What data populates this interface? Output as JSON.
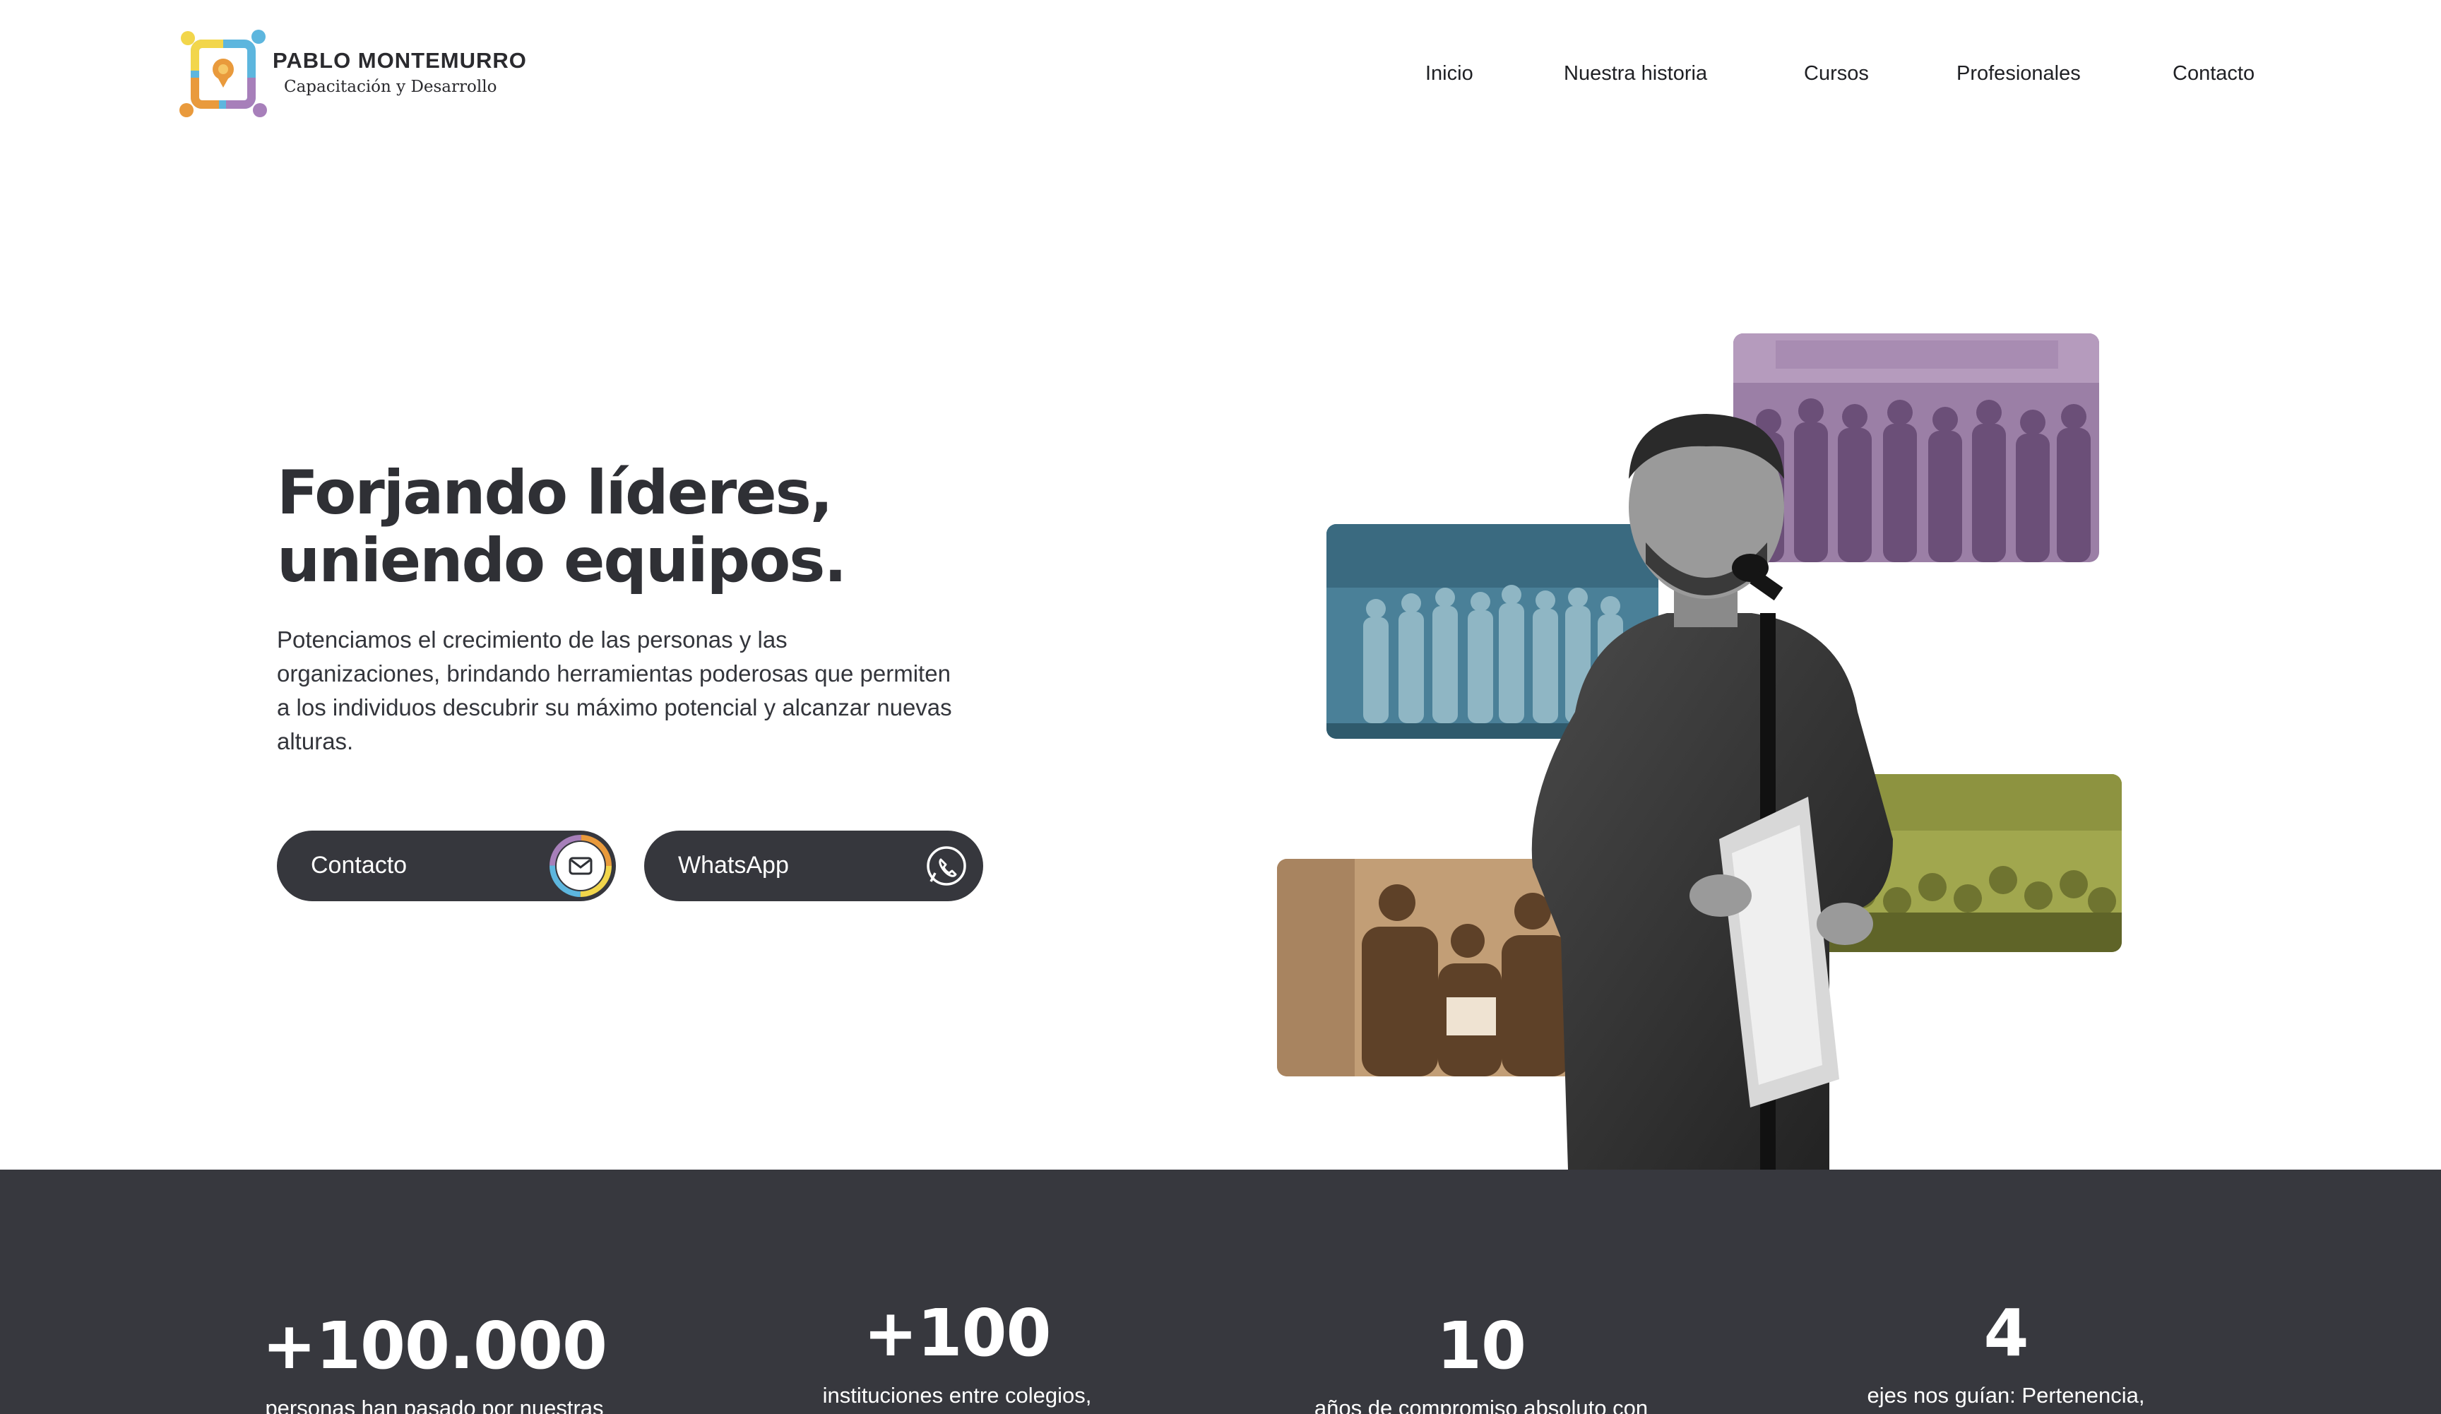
{
  "brand": {
    "name": "PABLO MONTEMURRO",
    "tagline": "Capacitación y Desarrollo"
  },
  "nav": {
    "items": [
      "Inicio",
      "Nuestra historia",
      "Cursos",
      "Profesionales",
      "Contacto"
    ]
  },
  "hero": {
    "title": "Forjando líderes, uniendo equipos.",
    "description": "Potenciamos el crecimiento de las personas y las organizaciones, brindando herramientas poderosas que permiten a los individuos descubrir su máximo potencial y alcanzar nuevas alturas.",
    "buttons": {
      "contact": "Contacto",
      "whatsapp": "WhatsApp"
    },
    "button_icons": {
      "contact": "envelope-icon",
      "whatsapp": "phone-icon"
    }
  },
  "stats": [
    {
      "value": "+100.000",
      "description": "personas han pasado por nuestras"
    },
    {
      "value": "+100",
      "description": "instituciones entre colegios,"
    },
    {
      "value": "10",
      "description": "años de compromiso absoluto con"
    },
    {
      "value": "4",
      "description": "ejes nos guían: Pertenencia,"
    }
  ],
  "colors": {
    "dark": "#37383e",
    "button": "#36373d",
    "accent_yellow": "#f2d64b",
    "accent_orange": "#e99a3c",
    "accent_purple": "#a77fba",
    "accent_blue": "#5db6de",
    "photo_purple": "#8e6f98",
    "photo_teal": "#41788f",
    "photo_olive": "#9aa14a",
    "photo_tan": "#b48f67"
  }
}
